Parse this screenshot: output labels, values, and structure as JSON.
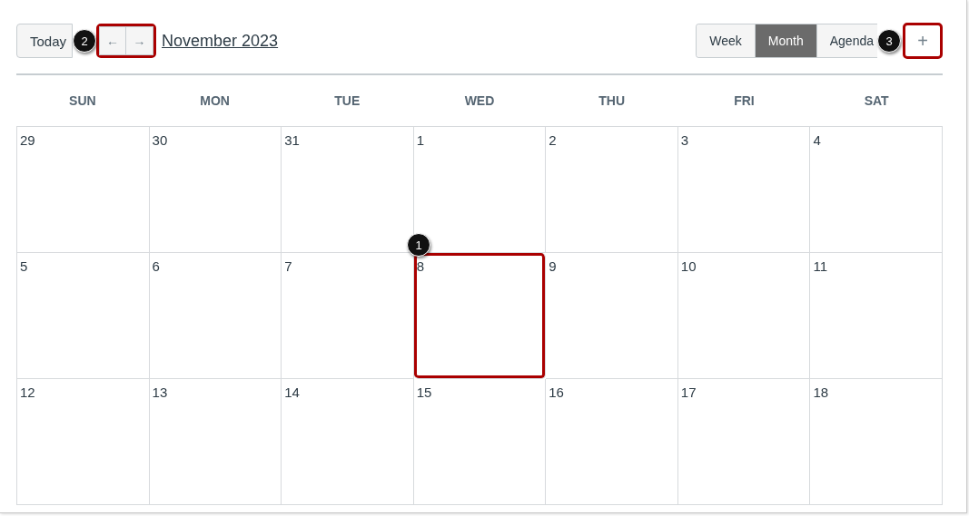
{
  "toolbar": {
    "today_button": "Today",
    "nav": {
      "prev": "←",
      "next": "→",
      "highlighted": true,
      "callout": "2"
    },
    "title": "November 2023",
    "views": [
      {
        "label": "Week",
        "selected": false
      },
      {
        "label": "Month",
        "selected": true
      },
      {
        "label": "Agenda",
        "selected": false
      }
    ],
    "add_button": {
      "label": "+",
      "highlighted": true,
      "callout": "3"
    }
  },
  "weekdays": [
    "SUN",
    "MON",
    "TUE",
    "WED",
    "THU",
    "FRI",
    "SAT"
  ],
  "weeks": [
    [
      {
        "day": "29",
        "highlighted": false
      },
      {
        "day": "30",
        "highlighted": false
      },
      {
        "day": "31",
        "highlighted": false
      },
      {
        "day": "1",
        "highlighted": false
      },
      {
        "day": "2",
        "highlighted": false
      },
      {
        "day": "3",
        "highlighted": false
      },
      {
        "day": "4",
        "highlighted": false
      }
    ],
    [
      {
        "day": "5",
        "highlighted": false
      },
      {
        "day": "6",
        "highlighted": false
      },
      {
        "day": "7",
        "highlighted": false
      },
      {
        "day": "8",
        "highlighted": true,
        "callout": "1"
      },
      {
        "day": "9",
        "highlighted": false
      },
      {
        "day": "10",
        "highlighted": false
      },
      {
        "day": "11",
        "highlighted": false
      }
    ],
    [
      {
        "day": "12",
        "highlighted": false
      },
      {
        "day": "13",
        "highlighted": false
      },
      {
        "day": "14",
        "highlighted": false
      },
      {
        "day": "15",
        "highlighted": false
      },
      {
        "day": "16",
        "highlighted": false
      },
      {
        "day": "17",
        "highlighted": false
      },
      {
        "day": "18",
        "highlighted": false
      }
    ]
  ]
}
